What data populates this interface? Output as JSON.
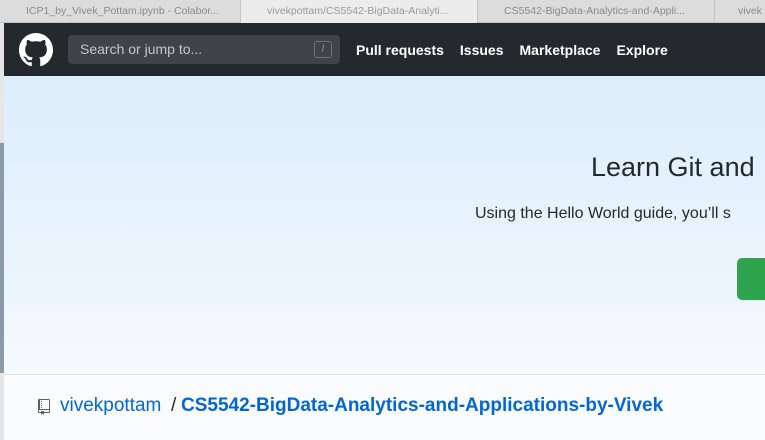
{
  "browser": {
    "tabs": [
      {
        "label": "ICP1_by_Vivek_Pottam.ipynb - Colabor..."
      },
      {
        "label": "vivekpottam/CS5542-BigData-Analyti..."
      },
      {
        "label": "CS5542-BigData-Analytics-and-Appli..."
      },
      {
        "label": "vivek"
      }
    ],
    "active_tab_index": 1
  },
  "header": {
    "search_placeholder": "Search or jump to...",
    "search_shortcut": "/",
    "nav": [
      "Pull requests",
      "Issues",
      "Marketplace",
      "Explore"
    ],
    "logo_icon": "github-octocat-icon"
  },
  "hero": {
    "title": "Learn Git and",
    "subtitle": "Using the Hello World guide, you’ll s",
    "button_color": "#2ea44f"
  },
  "repo": {
    "owner": "vivekpottam",
    "separator": "/",
    "name": "CS5542-BigData-Analytics-and-Applications-by-Vivek",
    "icon": "repo-icon"
  },
  "colors": {
    "header_bg": "#24292e",
    "link": "#0366d6"
  }
}
